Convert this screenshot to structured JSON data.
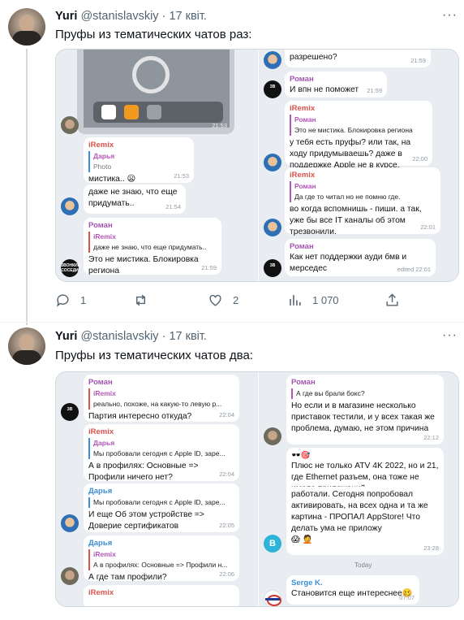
{
  "tweets": [
    {
      "name": "Yuri",
      "handle": "@stanislavskiy",
      "separator": "·",
      "date": "17 квіт.",
      "text": "Пруфы из тематических чатов раз:",
      "more": "···",
      "stats": {
        "replies": "1",
        "retweets": "",
        "likes": "2",
        "views": "1 070"
      },
      "chat_left": {
        "photo_time": "21:53",
        "m1": {
          "sender": "iRemix",
          "q_name": "Дарья",
          "q_text": "Photo",
          "text": "мистика.. 😦",
          "time": "21:53"
        },
        "m2": {
          "text": "даже не знаю, что еще придумать..",
          "time": "21:54"
        },
        "m3": {
          "sender": "Роман",
          "q_name": "iRemix",
          "q_text": "даже не знаю, что еще придумать..",
          "text": "Это не мистика. Блокировка региона",
          "time": "21:59"
        },
        "logo_text": "ЗВОНКИЕ СОСЕДИ"
      },
      "chat_right": {
        "m0": {
          "text": "разрешено?",
          "time": "21:59"
        },
        "m1": {
          "sender": "Роман",
          "text": "И впн не поможет",
          "time": "21:59"
        },
        "m2": {
          "sender": "iRemix",
          "q_name": "Роман",
          "q_text": "Это не мистика. Блокировка региона",
          "text": "у тебя есть пруфы? или так, на ходу придумываешь? даже в поддержке Apple не в курсе.",
          "time": "22:00"
        },
        "m3": {
          "sender": "iRemix",
          "q_name": "Роман",
          "q_text": "Да где то читал но не помню где.",
          "text": "во когда вспомнишь - пиши. а так, уже бы все IT каналы об этом трезвонили.",
          "time": "22:01"
        },
        "m4": {
          "sender": "Роман",
          "text": "Как нет поддержки ауди бмв и мерседес",
          "time": "edited 22:01"
        }
      }
    },
    {
      "name": "Yuri",
      "handle": "@stanislavskiy",
      "separator": "·",
      "date": "17 квіт.",
      "text": "Пруфы из тематических чатов два:",
      "more": "···",
      "chat_left": {
        "m1": {
          "sender": "Роман",
          "q_name": "iRemix",
          "q_text": "реально, похоже, на какую-то левую р...",
          "text": "Партия интересно откуда?",
          "time": "22:04"
        },
        "m2": {
          "sender": "iRemix",
          "q_name": "Дарья",
          "q_text": "Мы пробовали сегодня с Apple ID, заре...",
          "text": "А в профилях: Основные => Профили ничего нет?",
          "time": "22:04"
        },
        "m3": {
          "sender": "Дарья",
          "q_name": "",
          "q_text": "Мы пробовали сегодня с Apple ID, заре...",
          "text": "И еще Об этом устройстве => Доверие сертификатов",
          "time": "22:05"
        },
        "m4": {
          "sender": "Дарья",
          "q_name": "iRemix",
          "q_text": "А в профилях: Основные => Профили н...",
          "text": "А где там профили?",
          "time": "22:06"
        },
        "m5": {
          "sender": "iRemix"
        }
      },
      "chat_right": {
        "m1": {
          "sender": "Роман",
          "q_text": "А где вы брали бокс?",
          "text": "Но если и в магазине несколько приставок тестили, и у всех такая же проблема, думаю, не этом причина",
          "time": "22:12"
        },
        "m2": {
          "sender": "🕶️🎯",
          "text": "Плюс не только ATV 4K 2022, но и 21, где Ethernet разъем, она тоже не имела приложений"
        },
        "m3": {
          "text": "работали. Сегодня попробовал активировать, на всех одна и та же картина - ПРОПАЛ AppStore! Что делать ума не приложу",
          "emoji": "😱 🤦",
          "time": "23:28"
        },
        "day": "Today",
        "m4": {
          "sender": "Serge K.",
          "text": "Становится еще интереснее🥴",
          "time": "07:07"
        }
      }
    }
  ]
}
